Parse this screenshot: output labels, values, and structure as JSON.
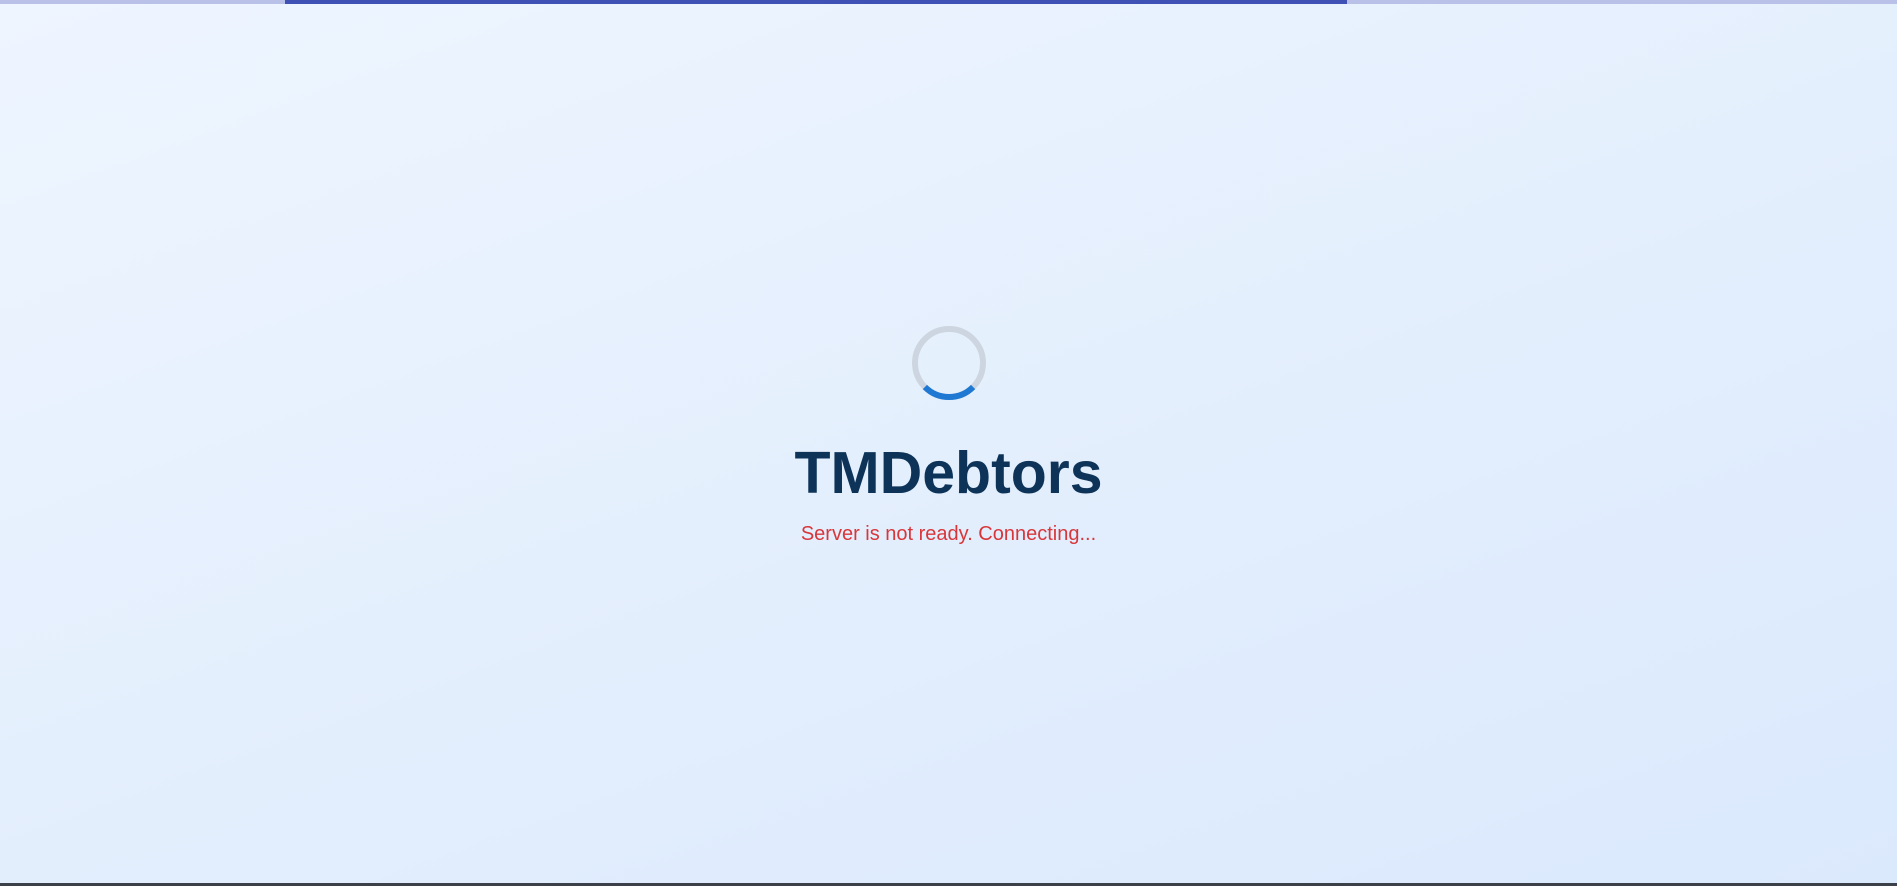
{
  "app": {
    "title": "TMDebtors",
    "status_message": "Server is not ready. Connecting..."
  },
  "loading_bar": {
    "progress_segment_percent": [
      15,
      71
    ],
    "color": "#3f51b5",
    "track_color": "#b9c1e8"
  },
  "spinner": {
    "icon": "loading-spinner-icon",
    "color": "#1f78d1",
    "track_color": "#cdd6e0"
  },
  "colors": {
    "title": "#0d3358",
    "status": "#d9363a"
  }
}
